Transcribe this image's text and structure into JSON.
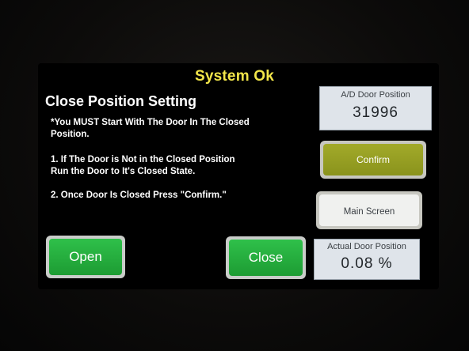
{
  "status": "System Ok",
  "title": "Close Position Setting",
  "instructions": {
    "note_line1": "*You MUST Start With The Door In The Closed",
    "note_line2": "Position.",
    "step1_line1": "1. If The Door is Not in the Closed Position",
    "step1_line2": "Run the Door to It's Closed State.",
    "step2": "2. Once Door Is Closed Press \"Confirm.\""
  },
  "ad_door_position": {
    "label": "A/D Door Position",
    "value": "31996"
  },
  "actual_door_position": {
    "label": "Actual Door Position",
    "value": "0.08 %"
  },
  "buttons": {
    "confirm": "Confirm",
    "main_screen": "Main Screen",
    "open": "Open",
    "close": "Close"
  },
  "colors": {
    "status_yellow": "#f2e64a",
    "confirm_olive": "#98a024",
    "action_green": "#27b23f",
    "readout_bg": "#dfe4ea"
  }
}
